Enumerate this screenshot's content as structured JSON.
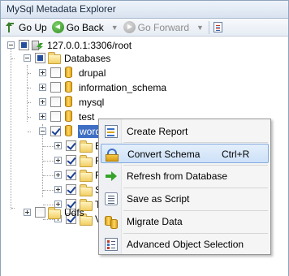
{
  "window": {
    "title": "MySql Metadata Explorer"
  },
  "toolbar": {
    "go_up": "Go Up",
    "go_back": "Go Back",
    "go_forward": "Go Forward",
    "go_up_icon": "arrow-up-icon",
    "go_back_icon": "back-arrow-icon",
    "go_forward_icon": "forward-arrow-icon",
    "extra_icon": "document-list-icon"
  },
  "tree": {
    "root": "127.0.0.1:3306/root",
    "databases": "Databases",
    "items": [
      "drupal",
      "information_schema",
      "mysql",
      "test",
      "wordpress"
    ],
    "wordpress_children_initials": [
      "E",
      "F",
      "F",
      "S",
      "T",
      "V"
    ],
    "udfs": "Udfs",
    "selected_color": "#3e6fc3"
  },
  "context_menu": {
    "items": [
      {
        "label": "Create Report",
        "shortcut": "",
        "icon": "report-icon"
      },
      {
        "label": "Convert Schema",
        "shortcut": "Ctrl+R",
        "icon": "convert-schema-icon",
        "highlighted": true
      },
      {
        "label": "Refresh from Database",
        "shortcut": "",
        "icon": "refresh-arrow-icon"
      },
      {
        "label": "Save as Script",
        "shortcut": "",
        "icon": "script-icon"
      },
      {
        "label": "Migrate Data",
        "shortcut": "",
        "icon": "migrate-data-icon"
      },
      {
        "label": "Advanced Object Selection",
        "shortcut": "",
        "icon": "advanced-selection-icon"
      }
    ],
    "highlight_color": "#cde1f8"
  }
}
